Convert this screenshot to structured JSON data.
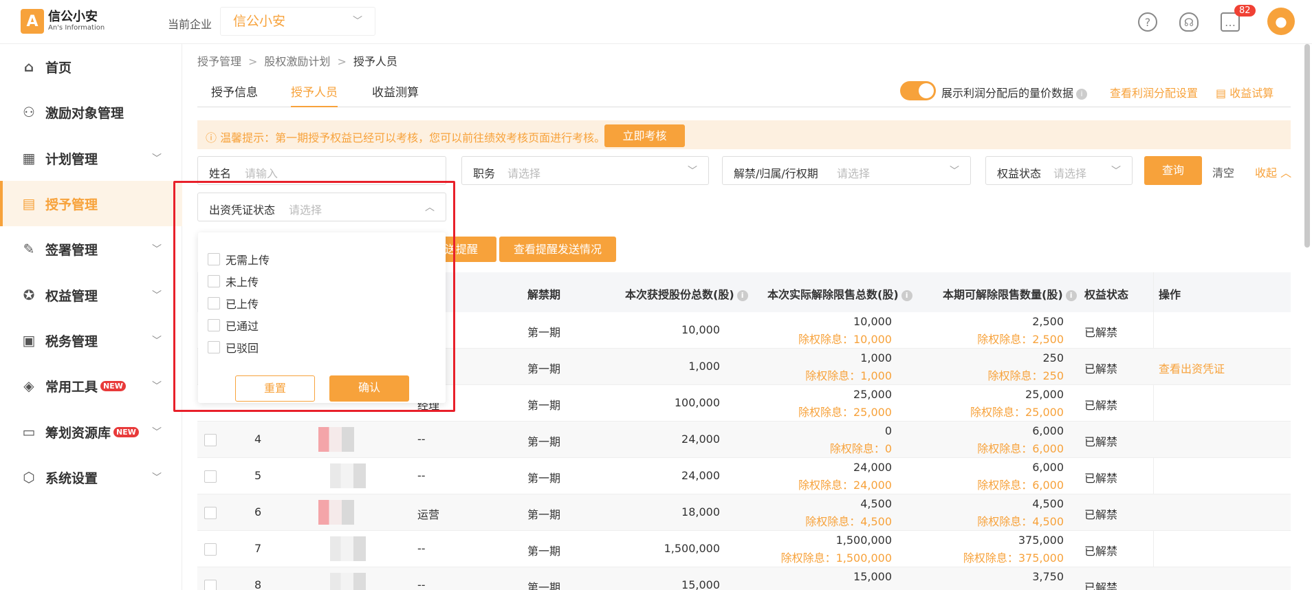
{
  "header": {
    "logo_cn": "信公小安",
    "logo_en": "An's Information",
    "company_label": "当前企业",
    "company_value": "信公小安",
    "message_count": "82"
  },
  "sidebar": {
    "items": [
      {
        "label": "首页",
        "icon": "home-icon"
      },
      {
        "label": "激励对象管理",
        "icon": "users-icon"
      },
      {
        "label": "计划管理",
        "icon": "grid-icon"
      },
      {
        "label": "授予管理",
        "icon": "document-icon"
      },
      {
        "label": "签署管理",
        "icon": "pen-icon"
      },
      {
        "label": "权益管理",
        "icon": "badge-icon"
      },
      {
        "label": "税务管理",
        "icon": "tax-icon"
      },
      {
        "label": "常用工具",
        "icon": "layers-icon",
        "tag": "NEW"
      },
      {
        "label": "筹划资源库",
        "icon": "toolbox-icon",
        "tag": "NEW"
      },
      {
        "label": "系统设置",
        "icon": "settings-icon"
      }
    ]
  },
  "breadcrumb": [
    "授予管理",
    "股权激励计划",
    "授予人员"
  ],
  "tabs": [
    "授予信息",
    "授予人员",
    "收益测算"
  ],
  "toolbar": {
    "toggle_label": "展示利润分配后的量价数据",
    "profit_link": "查看利润分配设置",
    "calc_link": "收益试算"
  },
  "notice": {
    "text": "ⓘ 温馨提示：第一期授予权益已经可以考核，您可以前往绩效考核页面进行考核。",
    "button": "立即考核"
  },
  "filters": {
    "name_label": "姓名",
    "name_placeholder": "请输入",
    "position_label": "职务",
    "position_placeholder": "请选择",
    "period_label": "解禁/归属/行权期",
    "period_placeholder": "请选择",
    "rights_label": "权益状态",
    "rights_placeholder": "请选择",
    "query": "查询",
    "clear": "清空",
    "collapse": "收起",
    "voucher_label": "出资凭证状态",
    "voucher_placeholder": "请选择"
  },
  "dropdown": {
    "options": [
      "无需上传",
      "未上传",
      "已上传",
      "已通过",
      "已驳回"
    ],
    "reset": "重置",
    "confirm": "确认"
  },
  "actions": {
    "remind_partial": "送提醒",
    "view_remind": "查看提醒发送情况"
  },
  "table": {
    "headers": [
      "解禁期",
      "本次获授股份总数(股)",
      "本次实际解除限售总数(股)",
      "本期可解除限售数量(股)",
      "权益状态",
      "操作"
    ],
    "rows": [
      {
        "no": "",
        "pos": "",
        "period": "第一期",
        "total": "10,000",
        "actual": "10,000",
        "actual_sub": "除权除息：10,000",
        "avail": "2,500",
        "avail_sub": "除权除息：2,500",
        "status": "已解禁",
        "op": ""
      },
      {
        "no": "",
        "pos": "",
        "period": "第一期",
        "total": "1,000",
        "actual": "1,000",
        "actual_sub": "除权除息：1,000",
        "avail": "250",
        "avail_sub": "除权除息：250",
        "status": "已解禁",
        "op": "查看出资凭证"
      },
      {
        "no": "",
        "pos": "经理",
        "period": "第一期",
        "total": "100,000",
        "actual": "25,000",
        "actual_sub": "除权除息：25,000",
        "avail": "25,000",
        "avail_sub": "除权除息：25,000",
        "status": "已解禁",
        "op": ""
      },
      {
        "no": "4",
        "pos": "--",
        "period": "第一期",
        "total": "24,000",
        "actual": "0",
        "actual_sub": "除权除息：0",
        "avail": "6,000",
        "avail_sub": "除权除息：6,000",
        "status": "已解禁",
        "op": ""
      },
      {
        "no": "5",
        "pos": "--",
        "period": "第一期",
        "total": "24,000",
        "actual": "24,000",
        "actual_sub": "除权除息：24,000",
        "avail": "6,000",
        "avail_sub": "除权除息：6,000",
        "status": "已解禁",
        "op": ""
      },
      {
        "no": "6",
        "pos": "运营",
        "period": "第一期",
        "total": "18,000",
        "actual": "4,500",
        "actual_sub": "除权除息：4,500",
        "avail": "4,500",
        "avail_sub": "除权除息：4,500",
        "status": "已解禁",
        "op": ""
      },
      {
        "no": "7",
        "pos": "--",
        "period": "第一期",
        "total": "1,500,000",
        "actual": "1,500,000",
        "actual_sub": "除权除息：1,500,000",
        "avail": "375,000",
        "avail_sub": "除权除息：375,000",
        "status": "已解禁",
        "op": ""
      },
      {
        "no": "8",
        "pos": "--",
        "period": "第一期",
        "total": "15,000",
        "actual": "15,000",
        "actual_sub": "",
        "avail": "3,750",
        "avail_sub": "",
        "status": "已解禁",
        "op": ""
      }
    ]
  },
  "colors": {
    "accent": "#f7a23b",
    "highlight_frame": "#e8202a"
  }
}
